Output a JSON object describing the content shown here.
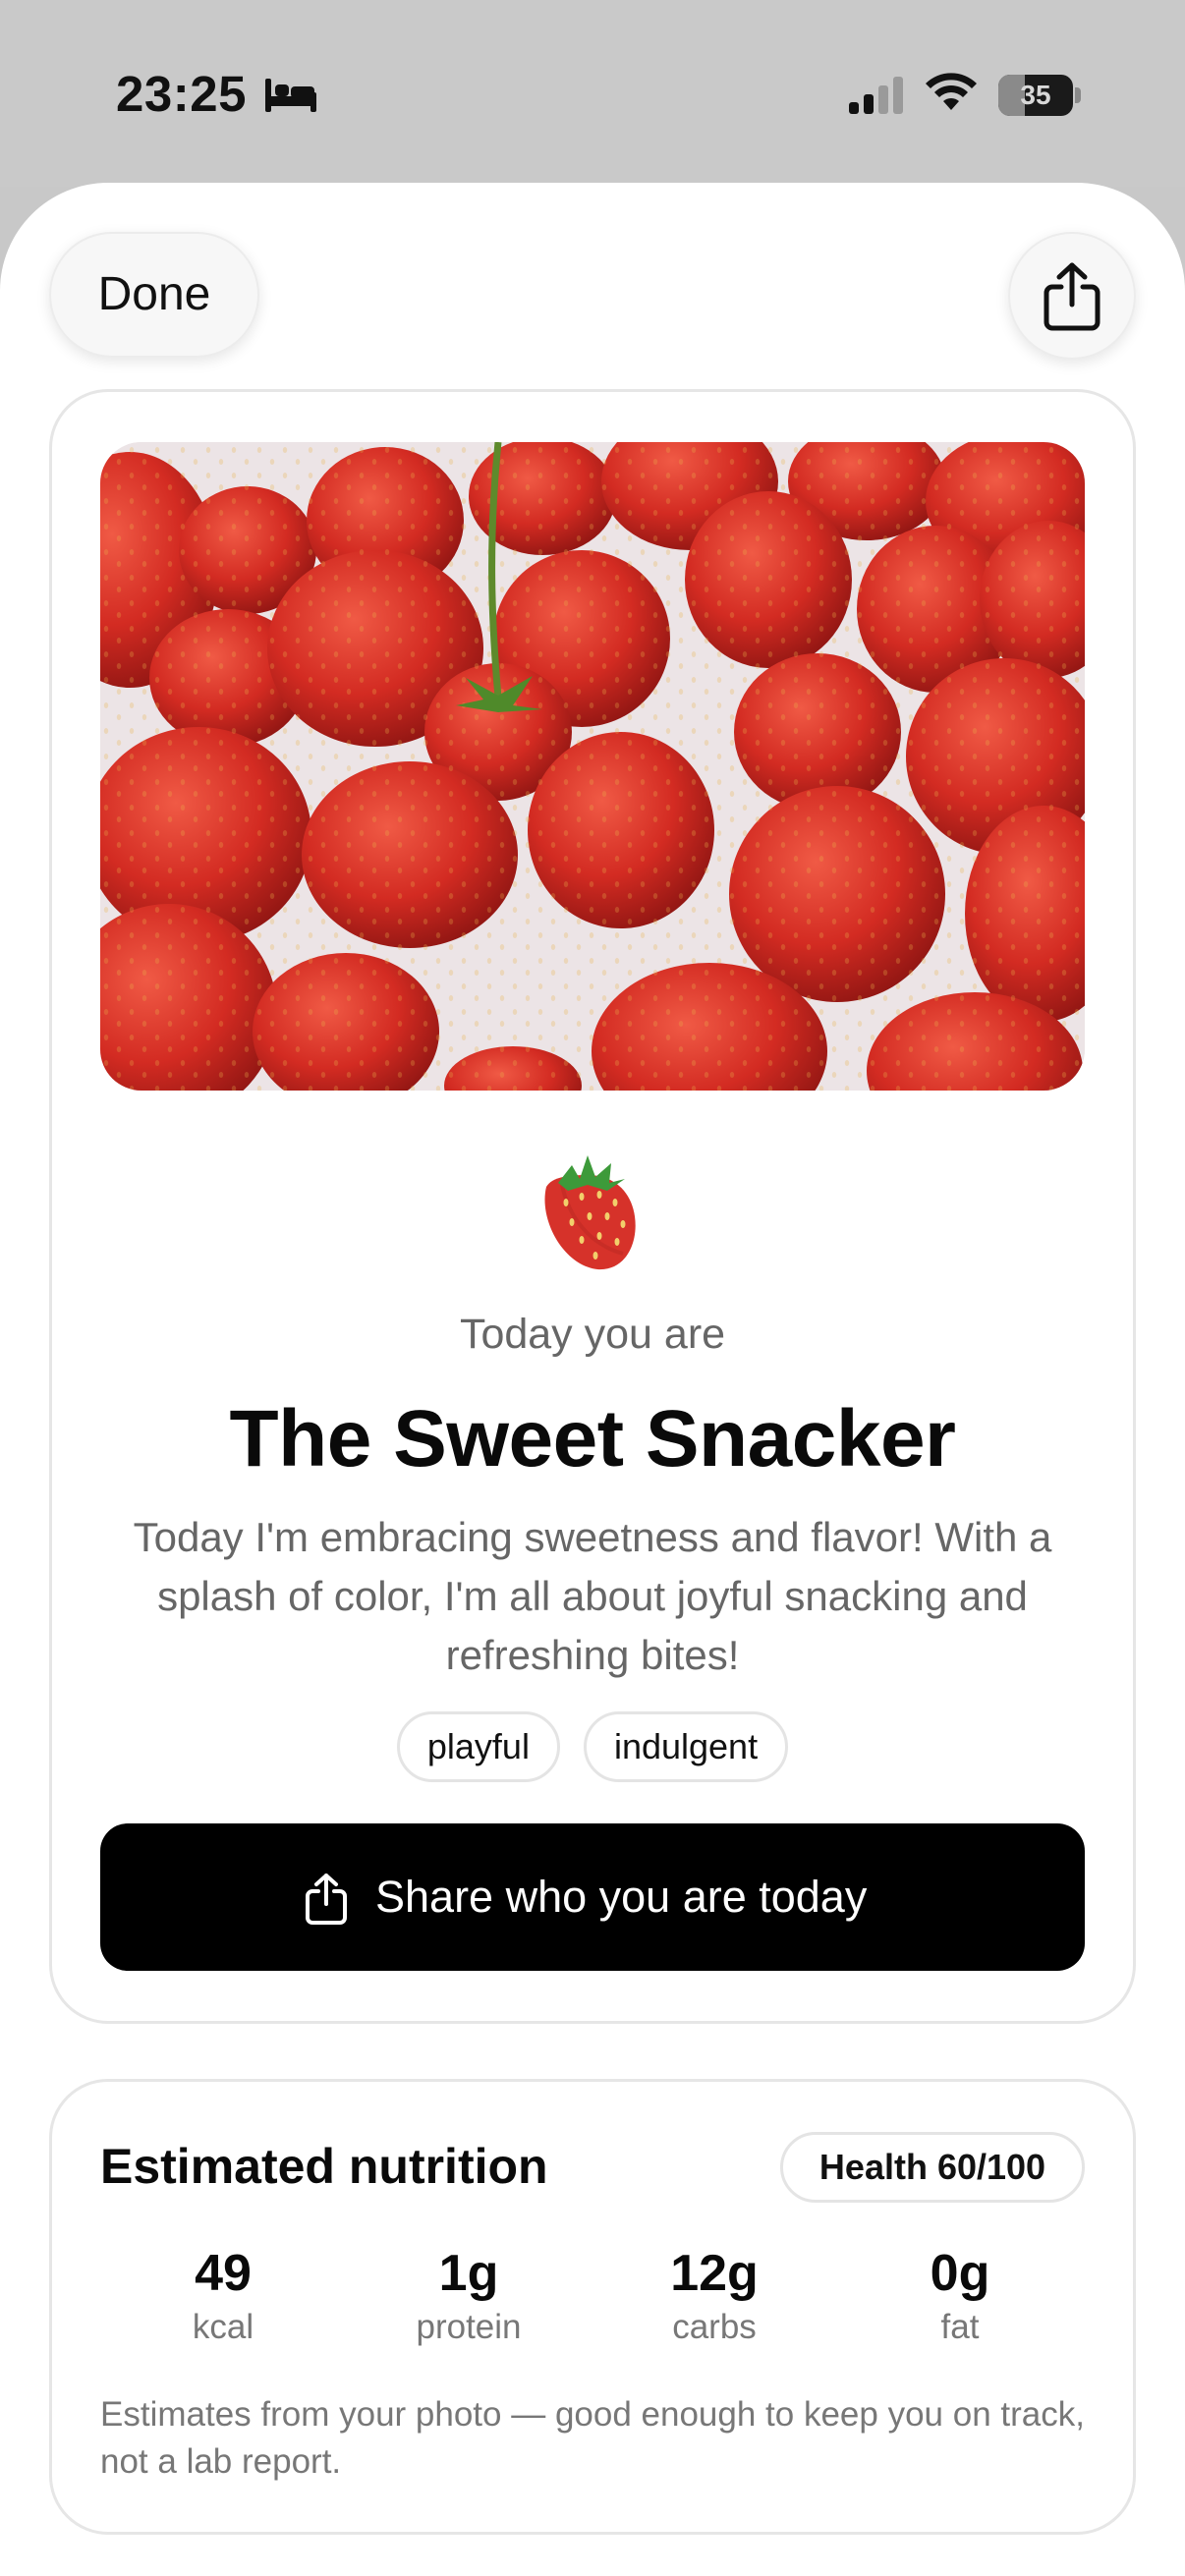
{
  "status_bar": {
    "time": "23:25",
    "battery": "35",
    "battery_level": 0.35,
    "icons": [
      "bed-icon",
      "cellular-signal-icon",
      "wifi-icon",
      "battery-icon"
    ]
  },
  "header": {
    "done_label": "Done",
    "share_icon": "share-icon"
  },
  "persona": {
    "photo_subject": "strawberries",
    "emoji": "🍓",
    "intro": "Today you are",
    "title": "The Sweet Snacker",
    "description": "Today I'm embracing sweetness and flavor! With a splash of color, I'm all about joyful snacking and refreshing bites!",
    "tags": [
      "playful",
      "indulgent"
    ],
    "share_label": "Share who you are today"
  },
  "nutrition": {
    "title": "Estimated nutrition",
    "health_badge": "Health 60/100",
    "items": [
      {
        "value": "49",
        "label": "kcal"
      },
      {
        "value": "1g",
        "label": "protein"
      },
      {
        "value": "12g",
        "label": "carbs"
      },
      {
        "value": "0g",
        "label": "fat"
      }
    ],
    "note": "Estimates from your photo — good enough to keep you on track, not a lab report."
  },
  "colors": {
    "accent": "#000000",
    "background": "#ffffff",
    "status_bar": "#c9c9c9",
    "strawberry": "#d8352a"
  }
}
